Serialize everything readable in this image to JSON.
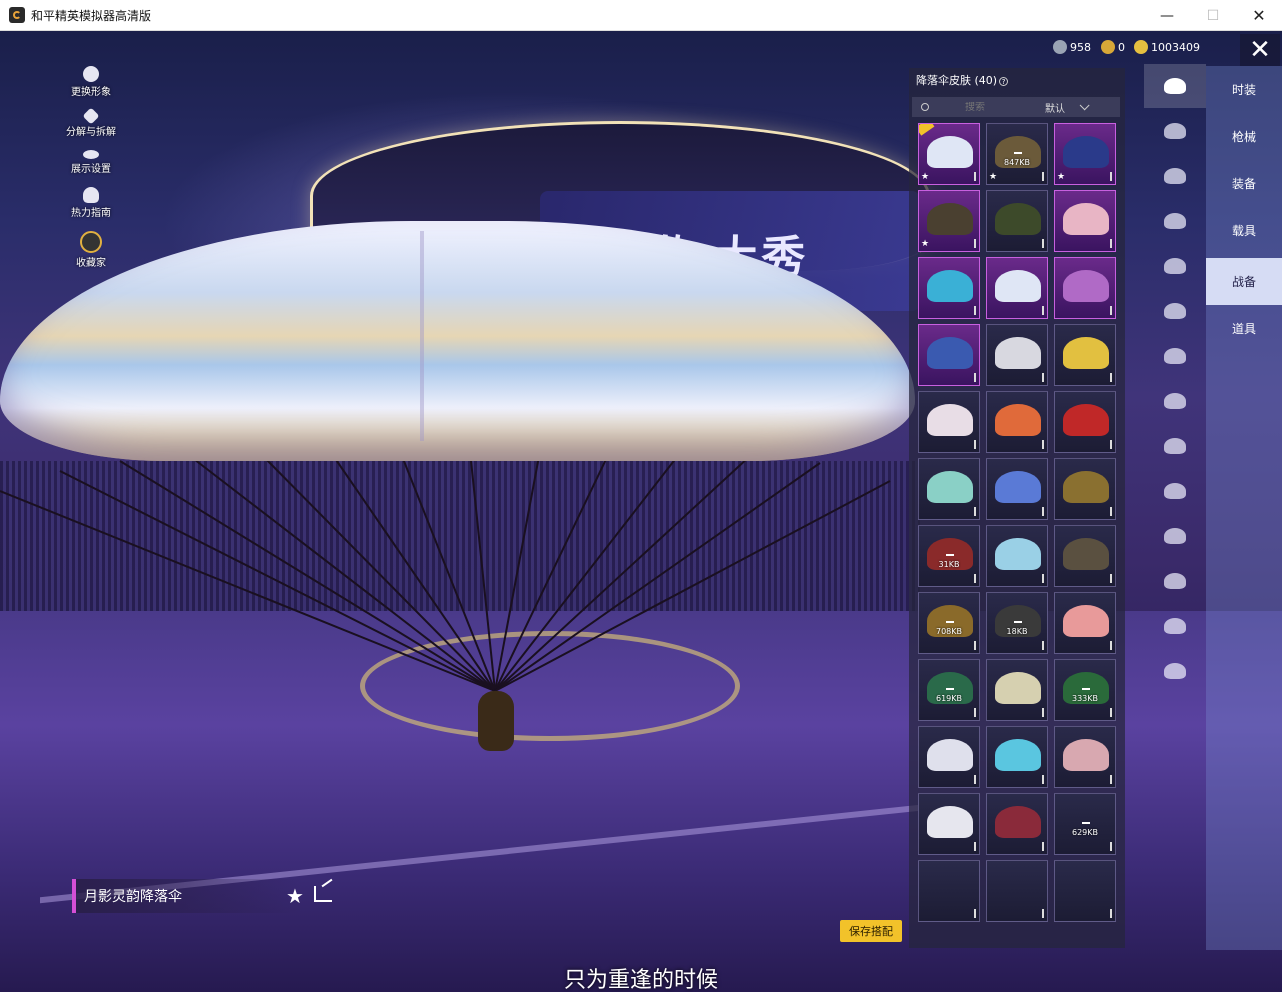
{
  "window": {
    "title": "和平精英模拟器高清版",
    "minimize": "—",
    "maximize": "☐",
    "close": "✕"
  },
  "left_menu": [
    {
      "label": "更换形象",
      "icon": "person-icon"
    },
    {
      "label": "分解与拆解",
      "icon": "puzzle-icon"
    },
    {
      "label": "展示设置",
      "icon": "eye-icon"
    },
    {
      "label": "热力指南",
      "icon": "fire-icon"
    },
    {
      "label": "收藏家",
      "icon": "collector-badge-icon"
    }
  ],
  "currency": [
    {
      "value": "958",
      "icon": "silver-coin-icon"
    },
    {
      "value": "0",
      "icon": "gold-coin-icon"
    },
    {
      "value": "1003409",
      "icon": "coupon-icon"
    }
  ],
  "close_label": "✕",
  "panel": {
    "title": "降落伞皮肤 (40)",
    "help": "?",
    "search_placeholder": "搜索",
    "sort": "默认"
  },
  "grid_items": [
    {
      "type": "legend",
      "color": "#dfe6f5",
      "checked": true,
      "fav": true,
      "size": ""
    },
    {
      "type": "normal",
      "color": "#6b5a3a",
      "checked": false,
      "fav": true,
      "size": "847KB"
    },
    {
      "type": "legend",
      "color": "#2a3a8a",
      "checked": false,
      "fav": true,
      "size": ""
    },
    {
      "type": "legend",
      "color": "#4a4030",
      "checked": false,
      "fav": true,
      "size": ""
    },
    {
      "type": "normal",
      "color": "#3d4a2a",
      "checked": false,
      "fav": false,
      "size": ""
    },
    {
      "type": "legend",
      "color": "#e8b5c5",
      "checked": false,
      "fav": false,
      "size": ""
    },
    {
      "type": "legend",
      "color": "#3ab0d6",
      "checked": false,
      "fav": false,
      "size": ""
    },
    {
      "type": "legend",
      "color": "#dfe6f5",
      "checked": false,
      "fav": false,
      "size": ""
    },
    {
      "type": "legend",
      "color": "#b06ac6",
      "checked": false,
      "fav": false,
      "size": ""
    },
    {
      "type": "legend",
      "color": "#3a5ab0",
      "checked": false,
      "fav": false,
      "size": ""
    },
    {
      "type": "normal",
      "color": "#d8d8e0",
      "checked": false,
      "fav": false,
      "size": ""
    },
    {
      "type": "normal",
      "color": "#e2c040",
      "checked": false,
      "fav": false,
      "size": ""
    },
    {
      "type": "normal",
      "color": "#e8dde6",
      "checked": false,
      "fav": false,
      "size": ""
    },
    {
      "type": "normal",
      "color": "#e06a3a",
      "checked": false,
      "fav": false,
      "size": ""
    },
    {
      "type": "normal",
      "color": "#c02828",
      "checked": false,
      "fav": false,
      "size": ""
    },
    {
      "type": "normal",
      "color": "#8ad0c6",
      "checked": false,
      "fav": false,
      "size": ""
    },
    {
      "type": "normal",
      "color": "#5a7ad6",
      "checked": false,
      "fav": false,
      "size": ""
    },
    {
      "type": "normal",
      "color": "#8a7030",
      "checked": false,
      "fav": false,
      "size": ""
    },
    {
      "type": "normal",
      "color": "#8a2a2a",
      "checked": false,
      "fav": false,
      "size": "31KB"
    },
    {
      "type": "normal",
      "color": "#9ad0e6",
      "checked": false,
      "fav": false,
      "size": ""
    },
    {
      "type": "normal",
      "color": "#5a5040",
      "checked": false,
      "fav": false,
      "size": ""
    },
    {
      "type": "normal",
      "color": "#8a6a2a",
      "checked": false,
      "fav": false,
      "size": "708KB"
    },
    {
      "type": "normal",
      "color": "#3a3a3a",
      "checked": false,
      "fav": false,
      "size": "18KB"
    },
    {
      "type": "normal",
      "color": "#e89a9a",
      "checked": false,
      "fav": false,
      "size": ""
    },
    {
      "type": "normal",
      "color": "#2a6a4a",
      "checked": false,
      "fav": false,
      "size": "619KB"
    },
    {
      "type": "normal",
      "color": "#d6d0b0",
      "checked": false,
      "fav": false,
      "size": ""
    },
    {
      "type": "normal",
      "color": "#2a6a3a",
      "checked": false,
      "fav": false,
      "size": "333KB"
    },
    {
      "type": "normal",
      "color": "#dfe0ec",
      "checked": false,
      "fav": false,
      "size": ""
    },
    {
      "type": "normal",
      "color": "#5ac6e0",
      "checked": false,
      "fav": false,
      "size": ""
    },
    {
      "type": "normal",
      "color": "#d8a8b0",
      "checked": false,
      "fav": false,
      "size": ""
    },
    {
      "type": "normal",
      "color": "#e6e6ee",
      "checked": false,
      "fav": false,
      "size": ""
    },
    {
      "type": "normal",
      "color": "#8a2a3a",
      "checked": false,
      "fav": false,
      "size": ""
    },
    {
      "type": "normal",
      "color": "",
      "checked": false,
      "fav": false,
      "size": "629KB"
    },
    {
      "type": "normal",
      "color": "",
      "checked": false,
      "fav": false,
      "size": ""
    },
    {
      "type": "normal",
      "color": "",
      "checked": false,
      "fav": false,
      "size": ""
    },
    {
      "type": "normal",
      "color": "",
      "checked": false,
      "fav": false,
      "size": ""
    }
  ],
  "icon_tabs": [
    {
      "name": "parachute-icon",
      "active": true
    },
    {
      "name": "glider-icon",
      "active": false
    },
    {
      "name": "plane-trail-icon",
      "active": false
    },
    {
      "name": "airplane-icon",
      "active": false
    },
    {
      "name": "emote-icon",
      "active": false
    },
    {
      "name": "jet-icon",
      "active": false
    },
    {
      "name": "robot-icon",
      "active": false
    },
    {
      "name": "speaker-icon",
      "active": false
    },
    {
      "name": "ticket-icon",
      "active": false
    },
    {
      "name": "image-icon",
      "active": false
    },
    {
      "name": "spray-icon",
      "active": false
    },
    {
      "name": "hand-icon",
      "active": false
    },
    {
      "name": "wand-icon",
      "active": false
    },
    {
      "name": "pan-icon",
      "active": false
    }
  ],
  "category_tabs": [
    {
      "label": "时装",
      "active": false
    },
    {
      "label": "枪械",
      "active": false
    },
    {
      "label": "装备",
      "active": false
    },
    {
      "label": "载具",
      "active": false
    },
    {
      "label": "战备",
      "active": true
    },
    {
      "label": "道具",
      "active": false
    }
  ],
  "banner_text": "让刺激  大秀",
  "item_name": "月影灵韵降落伞",
  "favorite_icon": "★",
  "save_label": "保存搭配",
  "subtitle": "只为重逢的时候"
}
